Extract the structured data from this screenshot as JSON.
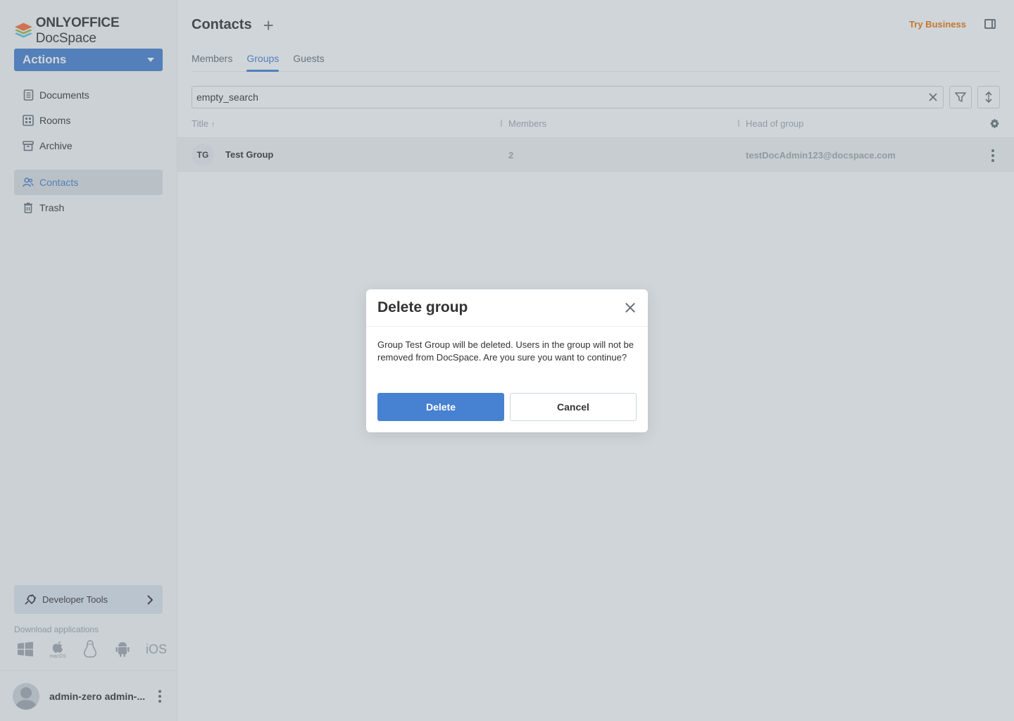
{
  "app": {
    "brand_bold": "ONLYOFFICE",
    "brand_light": "DocSpace"
  },
  "sidebar": {
    "actions_label": "Actions",
    "items": [
      {
        "label": "Documents",
        "icon": "document-icon"
      },
      {
        "label": "Rooms",
        "icon": "rooms-icon"
      },
      {
        "label": "Archive",
        "icon": "archive-icon"
      },
      {
        "label": "Contacts",
        "icon": "contacts-icon",
        "active": true
      },
      {
        "label": "Trash",
        "icon": "trash-icon"
      }
    ],
    "developer_tools": "Developer Tools",
    "download_title": "Download applications",
    "download_apps": [
      "windows-icon",
      "macos-icon",
      "linux-icon",
      "android-icon",
      "ios-icon"
    ],
    "macos_label": "macOS",
    "ios_label": "iOS",
    "profile_name": "admin-zero admin-..."
  },
  "header": {
    "title": "Contacts",
    "try_business": "Try Business"
  },
  "tabs": [
    {
      "label": "Members"
    },
    {
      "label": "Groups",
      "active": true
    },
    {
      "label": "Guests"
    }
  ],
  "search": {
    "value": "empty_search"
  },
  "table": {
    "columns": [
      "Title",
      "Members",
      "Head of group"
    ],
    "rows": [
      {
        "initials": "TG",
        "title": "Test Group",
        "members": "2",
        "head": "testDocAdmin123@docspace.com"
      }
    ]
  },
  "dialog": {
    "title": "Delete group",
    "message": "Group Test Group will be deleted. Users in the group will not be removed from DocSpace. Are you sure you want to continue?",
    "delete_label": "Delete",
    "cancel_label": "Cancel"
  },
  "colors": {
    "accent": "#4781d1",
    "try_business": "#ed7309"
  }
}
